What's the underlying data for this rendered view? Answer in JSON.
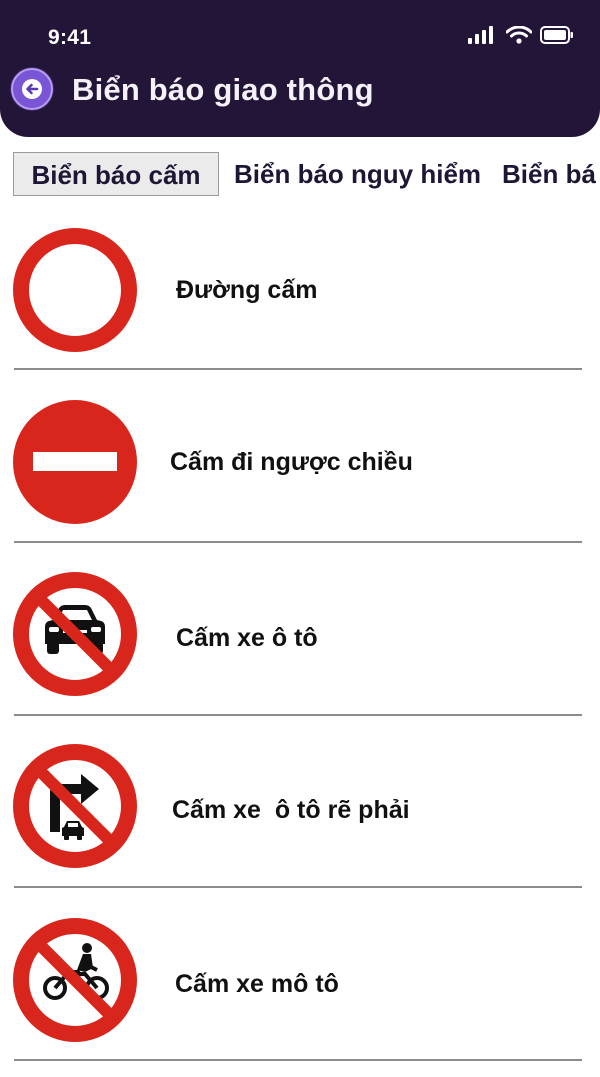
{
  "status_bar": {
    "time": "9:41"
  },
  "header": {
    "title": "Biển báo giao thông"
  },
  "tabs": [
    {
      "label": "Biển báo cấm",
      "active": true
    },
    {
      "label": "Biển báo nguy hiểm",
      "active": false
    },
    {
      "label": "Biển bá",
      "active": false
    }
  ],
  "signs": [
    {
      "label": "Đường cấm",
      "icon": "no-entry-circle-icon"
    },
    {
      "label": "Cấm đi ngược chiều",
      "icon": "no-entry-bar-icon"
    },
    {
      "label": "Cấm xe ô tô",
      "icon": "no-cars-icon"
    },
    {
      "label": "Cấm xe  ô tô rẽ phải",
      "icon": "no-car-right-turn-icon"
    },
    {
      "label": "Cấm xe mô tô",
      "icon": "no-motorcycles-icon"
    }
  ],
  "colors": {
    "header_bg": "#231537",
    "sign_red": "#d9261c",
    "back_button": "#7a56d6"
  }
}
